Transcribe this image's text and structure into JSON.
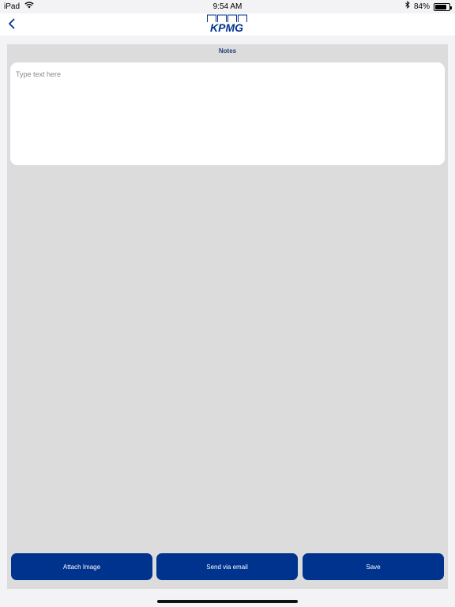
{
  "status_bar": {
    "device": "iPad",
    "time": "9:54 AM",
    "battery_percent": "84%",
    "battery_level": 0.84,
    "icons": [
      "wifi-icon",
      "bluetooth-icon",
      "battery-icon"
    ]
  },
  "nav": {
    "back_icon": "chevron-left-icon",
    "logo_text": "KPMG",
    "brand_color": "#00338d"
  },
  "notes": {
    "title": "Notes",
    "placeholder": "Type text here",
    "value": ""
  },
  "actions": {
    "attach_label": "Attach Image",
    "email_label": "Send via email",
    "save_label": "Save"
  }
}
